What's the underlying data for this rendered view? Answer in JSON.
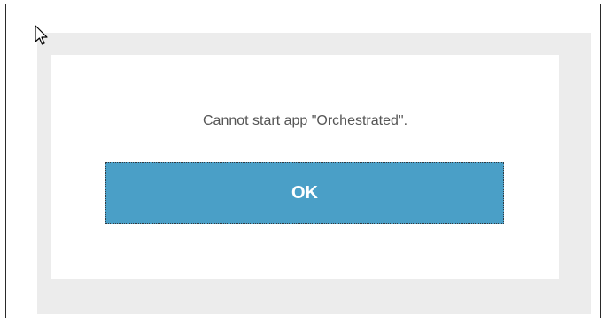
{
  "dialog": {
    "message": "Cannot start app \"Orchestrated\".",
    "ok_label": "OK"
  },
  "colors": {
    "button_bg": "#4a9fc7",
    "button_text": "#ffffff",
    "message_text": "#555555",
    "backdrop": "#ececec"
  },
  "icons": {
    "cursor": "mouse-pointer-icon"
  }
}
